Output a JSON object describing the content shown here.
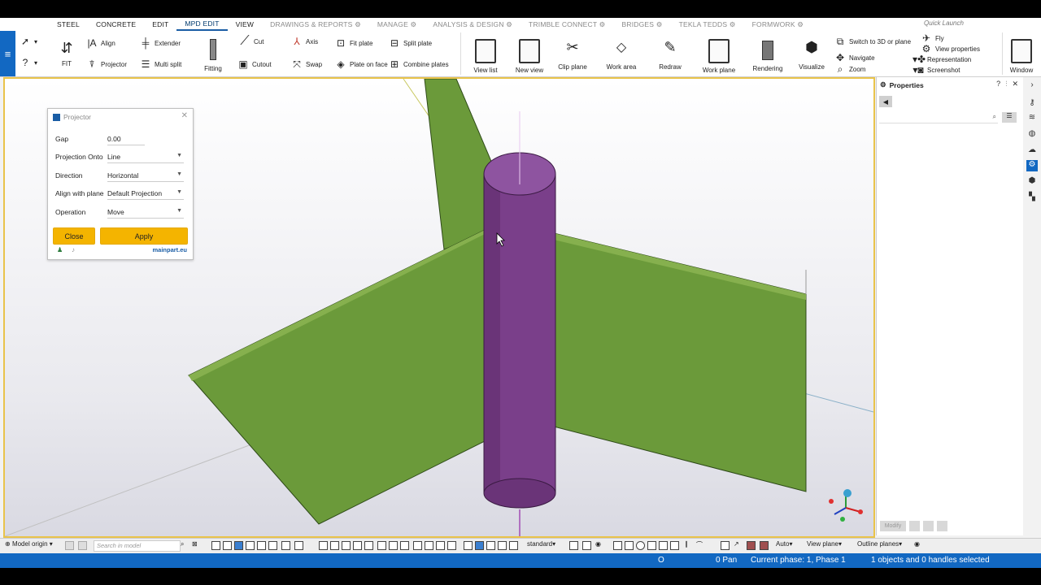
{
  "ribbon": {
    "tabs": [
      {
        "label": "STEEL",
        "state": "normal"
      },
      {
        "label": "CONCRETE",
        "state": "normal"
      },
      {
        "label": "EDIT",
        "state": "normal"
      },
      {
        "label": "MPD EDIT",
        "state": "active"
      },
      {
        "label": "VIEW",
        "state": "normal"
      },
      {
        "label": "DRAWINGS & REPORTS ⚙",
        "state": "dim"
      },
      {
        "label": "MANAGE ⚙",
        "state": "dim"
      },
      {
        "label": "ANALYSIS & DESIGN ⚙",
        "state": "dim"
      },
      {
        "label": "TRIMBLE CONNECT ⚙",
        "state": "dim"
      },
      {
        "label": "BRIDGES ⚙",
        "state": "dim"
      },
      {
        "label": "TEKLA TEDDS ⚙",
        "state": "dim"
      },
      {
        "label": "FORMWORK ⚙",
        "state": "dim"
      }
    ],
    "quick_launch_placeholder": "Quick Launch",
    "buttons": {
      "fit": "FIT",
      "align": "Align",
      "projector": "Projector",
      "extender": "Extender",
      "multi_split": "Multi split",
      "fitting": "Fitting",
      "cut": "Cut",
      "cutout": "Cutout",
      "axis": "Axis",
      "swap": "Swap",
      "fit_plate": "Fit plate",
      "plate_on_face": "Plate on face",
      "split_plate": "Split plate",
      "combine_plates": "Combine plates",
      "view_list": "View list",
      "new_view": "New view",
      "clip_plane": "Clip plane",
      "work_area": "Work area",
      "redraw": "Redraw",
      "work_plane": "Work plane",
      "rendering": "Rendering",
      "visualize": "Visualize",
      "switch_3d": "Switch to 3D or plane",
      "navigate": "Navigate",
      "zoom": "Zoom",
      "fly": "Fly",
      "view_properties": "View properties",
      "representation": "Representation",
      "screenshot": "Screenshot",
      "window": "Window"
    }
  },
  "dialog": {
    "title": "Projector",
    "fields": [
      {
        "label": "Gap",
        "value": "0.00"
      },
      {
        "label": "Projection Onto",
        "value": "Line"
      },
      {
        "label": "Direction",
        "value": "Horizontal"
      },
      {
        "label": "Align with plane",
        "value": "Default Projection"
      },
      {
        "label": "Operation",
        "value": "Move"
      }
    ],
    "close_label": "Close",
    "apply_label": "Apply",
    "brand": "mainpart.eu"
  },
  "properties": {
    "title": "Properties",
    "modify_label": "Modify"
  },
  "bottombar": {
    "model_origin": "Model origin",
    "search_placeholder": "Search in model",
    "standard": "standard",
    "auto": "Auto",
    "view_plane": "View plane",
    "outline_planes": "Outline planes"
  },
  "status": {
    "o_label": "O",
    "pan": "0 Pan",
    "phase": "Current phase: 1, Phase 1",
    "selection": "1 objects and 0 handles selected"
  },
  "colors": {
    "plate_green": "#6b9a3a",
    "column_purple": "#7a3f8a",
    "accent_blue": "#1268c2",
    "button_yellow": "#f4b400"
  }
}
